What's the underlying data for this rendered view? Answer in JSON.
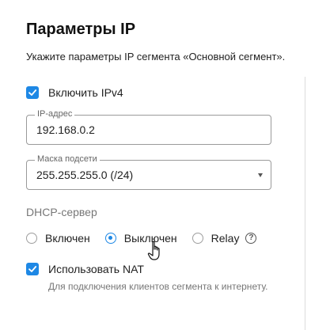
{
  "header": {
    "title": "Параметры IP",
    "subtitle": "Укажите параметры IP сегмента «Основной сегмент»."
  },
  "ipv4": {
    "label": "Включить IPv4",
    "checked": true
  },
  "ip_address": {
    "legend": "IP-адрес",
    "value": "192.168.0.2"
  },
  "subnet_mask": {
    "legend": "Маска подсети",
    "value": "255.255.255.0 (/24)"
  },
  "dhcp": {
    "label": "DHCP-сервер",
    "options": [
      {
        "label": "Включен",
        "checked": false
      },
      {
        "label": "Выключен",
        "checked": true
      },
      {
        "label": "Relay",
        "checked": false
      }
    ],
    "help_icon": "help-circle-icon"
  },
  "nat": {
    "label": "Использовать NAT",
    "checked": true,
    "hint": "Для подключения клиентов сегмента к интернету."
  },
  "colors": {
    "accent": "#1e88e5",
    "muted_text": "#777777"
  }
}
